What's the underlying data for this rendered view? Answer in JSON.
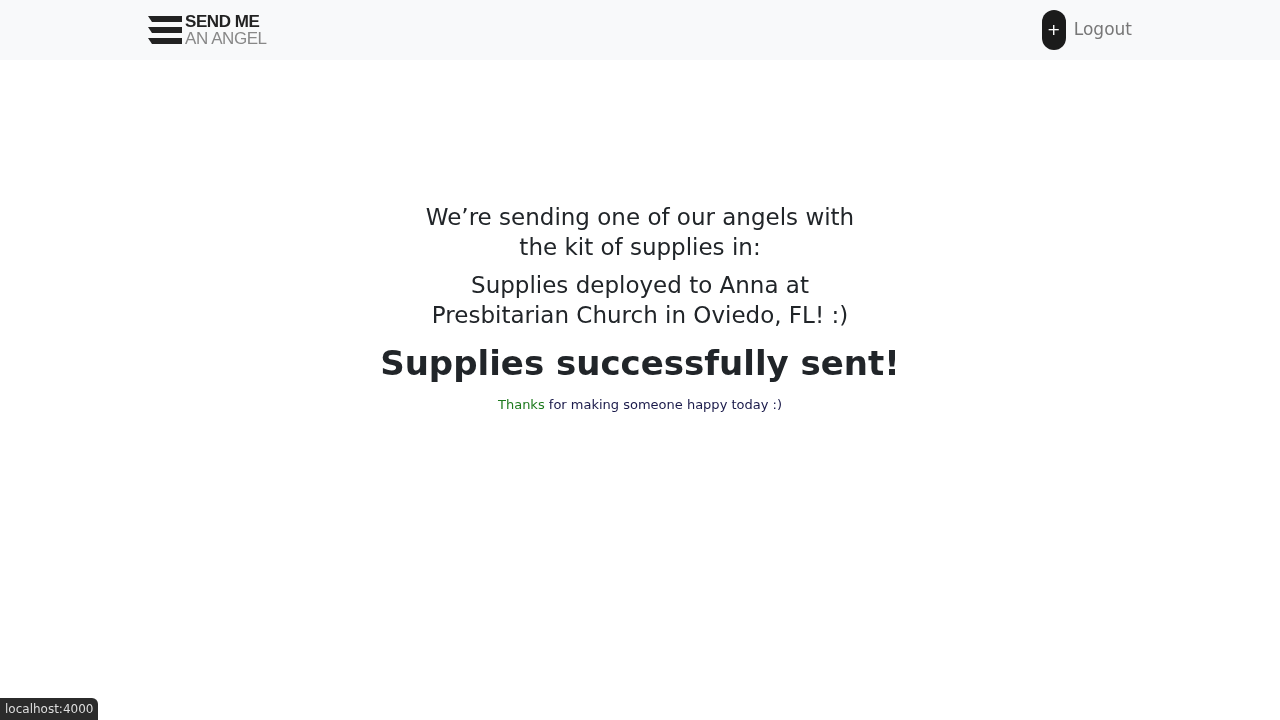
{
  "navbar": {
    "logo": {
      "line_1": "SEND ME",
      "line_2": "AN ANGEL"
    },
    "add_button": "+",
    "logout_link": "Logout"
  },
  "main": {
    "intro": "We’re sending one of our angels with the kit of supplies in:",
    "deployment": "Supplies deployed to Anna at Presbitarian Church in Oviedo, FL! :)",
    "heading": "Supplies successfully sent!",
    "thanks": {
      "highlight": "Thanks",
      "rest": "for making someone happy today :)"
    }
  },
  "status_bar": {
    "url": "localhost:4000"
  }
}
